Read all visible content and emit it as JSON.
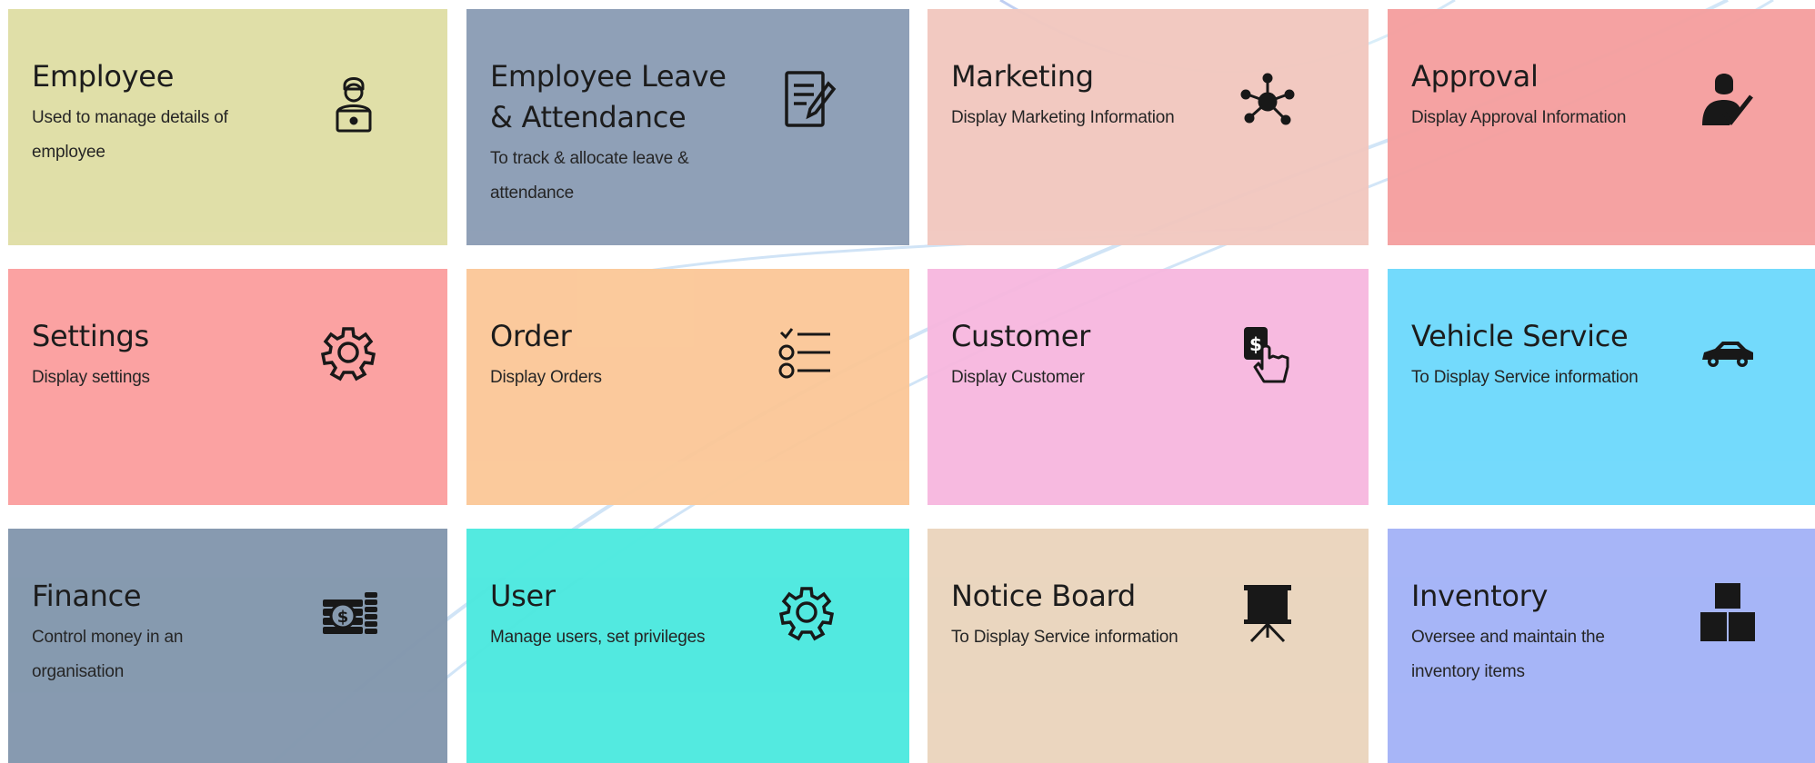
{
  "cards": [
    {
      "title": "Employee",
      "desc": "Used to manage details of employee",
      "icon": "employee-laptop-icon",
      "color": "#e0dea6"
    },
    {
      "title": "Employee Leave & Attendance",
      "desc": "To track & allocate leave & attendance",
      "icon": "document-edit-icon",
      "color": "#8c9db5"
    },
    {
      "title": "Marketing",
      "desc": "Display Marketing Information",
      "icon": "network-hub-icon",
      "color": "#f2c8c0"
    },
    {
      "title": "Approval",
      "desc": "Display Approval Information",
      "icon": "user-check-icon",
      "color": "#f5a0a0"
    },
    {
      "title": "Settings",
      "desc": "Display settings",
      "icon": "gear-icon",
      "color": "#fb9f9f"
    },
    {
      "title": "Order",
      "desc": "Display Orders",
      "icon": "checklist-icon",
      "color": "#fbc899"
    },
    {
      "title": "Customer",
      "desc": "Display Customer",
      "icon": "hand-tap-dollar-icon",
      "color": "#f7b8df"
    },
    {
      "title": "Vehicle Service",
      "desc": "To Display Service information",
      "icon": "car-icon",
      "color": "#6fd9fc"
    },
    {
      "title": "Finance",
      "desc": "Control money in an organisation",
      "icon": "money-coins-icon",
      "color": "#8397ad"
    },
    {
      "title": "User",
      "desc": "Manage users, set privileges",
      "icon": "gear-icon",
      "color": "#4de9df"
    },
    {
      "title": "Notice Board",
      "desc": "To Display Service information",
      "icon": "presentation-board-icon",
      "color": "#ead5bd"
    },
    {
      "title": "Inventory",
      "desc": "Oversee and maintain the inventory items",
      "icon": "boxes-icon",
      "color": "#a4b3f7"
    }
  ]
}
